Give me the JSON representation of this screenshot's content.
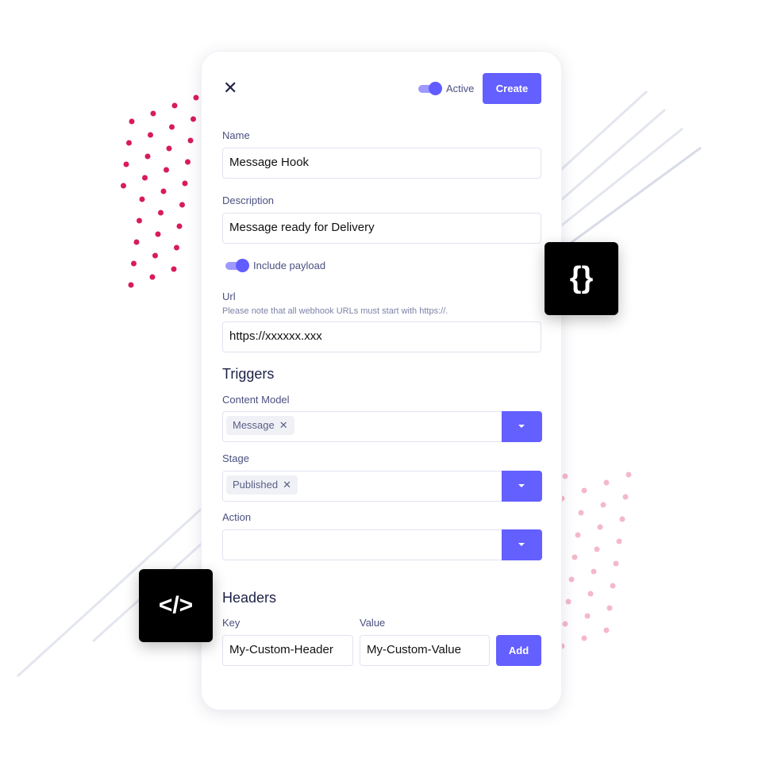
{
  "header": {
    "active_label": "Active",
    "active_on": true,
    "create_label": "Create"
  },
  "name": {
    "label": "Name",
    "value": "Message Hook"
  },
  "description": {
    "label": "Description",
    "value": "Message ready for Delivery"
  },
  "payload": {
    "label": "Include payload",
    "on": true
  },
  "url": {
    "label": "Url",
    "hint": "Please note that all webhook URLs must start with https://.",
    "value": "https://xxxxxx.xxx"
  },
  "triggers": {
    "title": "Triggers",
    "content_model": {
      "label": "Content Model",
      "chip": "Message"
    },
    "stage": {
      "label": "Stage",
      "chip": "Published"
    },
    "action": {
      "label": "Action"
    }
  },
  "headers": {
    "title": "Headers",
    "key_label": "Key",
    "value_label": "Value",
    "key": "My-Custom-Header",
    "value": "My-Custom-Value",
    "add_label": "Add"
  },
  "badges": {
    "braces": "{}",
    "code": "</>"
  },
  "colors": {
    "accent": "#645fff",
    "dots": "#d81b5a",
    "dots_light": "#f5b8cb"
  }
}
